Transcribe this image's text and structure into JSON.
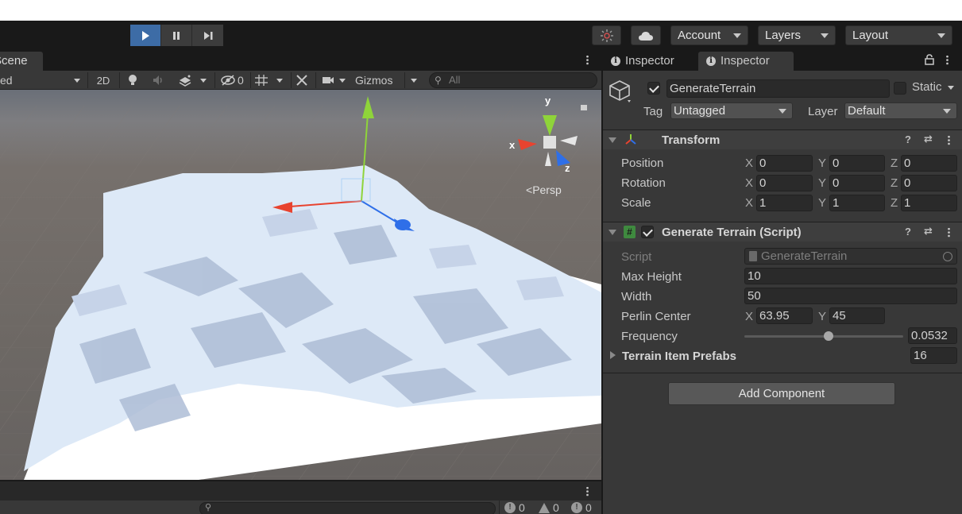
{
  "toolbar": {
    "account_label": "Account",
    "layers_label": "Layers",
    "layout_label": "Layout"
  },
  "scene": {
    "tab_label": "Scene",
    "shading_mode": "ed",
    "mode_2d": "2D",
    "hidden_count": "0",
    "gizmos_label": "Gizmos",
    "search_placeholder": "All",
    "persp_label": "Persp",
    "axis_x": "x",
    "axis_y": "y",
    "axis_z": "z"
  },
  "console": {
    "info_count": "0",
    "warning_count": "0",
    "error_count": "0"
  },
  "inspector": {
    "tabs": [
      {
        "label": "Inspector"
      },
      {
        "label": "Inspector"
      }
    ],
    "object_name": "GenerateTerrain",
    "static_label": "Static",
    "tag_label": "Tag",
    "tag_value": "Untagged",
    "layer_label": "Layer",
    "layer_value": "Default",
    "transform": {
      "title": "Transform",
      "position_label": "Position",
      "rotation_label": "Rotation",
      "scale_label": "Scale",
      "position": {
        "x": "0",
        "y": "0",
        "z": "0"
      },
      "rotation": {
        "x": "0",
        "y": "0",
        "z": "0"
      },
      "scale": {
        "x": "1",
        "y": "1",
        "z": "1"
      }
    },
    "script_component": {
      "title": "Generate Terrain (Script)",
      "script_label": "Script",
      "script_value": "GenerateTerrain",
      "max_height_label": "Max Height",
      "max_height_value": "10",
      "width_label": "Width",
      "width_value": "50",
      "perlin_center_label": "Perlin Center",
      "perlin_x": "63.95",
      "perlin_y": "45",
      "frequency_label": "Frequency",
      "frequency_value": "0.0532",
      "frequency_slider_fraction": 0.53,
      "terrain_prefabs_label": "Terrain Item Prefabs",
      "terrain_prefabs_count": "16"
    },
    "add_component_label": "Add Component",
    "axis_labels": {
      "x": "X",
      "y": "Y",
      "z": "Z"
    }
  },
  "colors": {
    "play_active": "#3d6ca6",
    "panel_bg": "#383838",
    "toolbar_bg": "#191919",
    "terrain": "#dde9f7",
    "gizmo_x": "#e8432f",
    "gizmo_y": "#8fd43a",
    "gizmo_z": "#2f6fe8"
  }
}
